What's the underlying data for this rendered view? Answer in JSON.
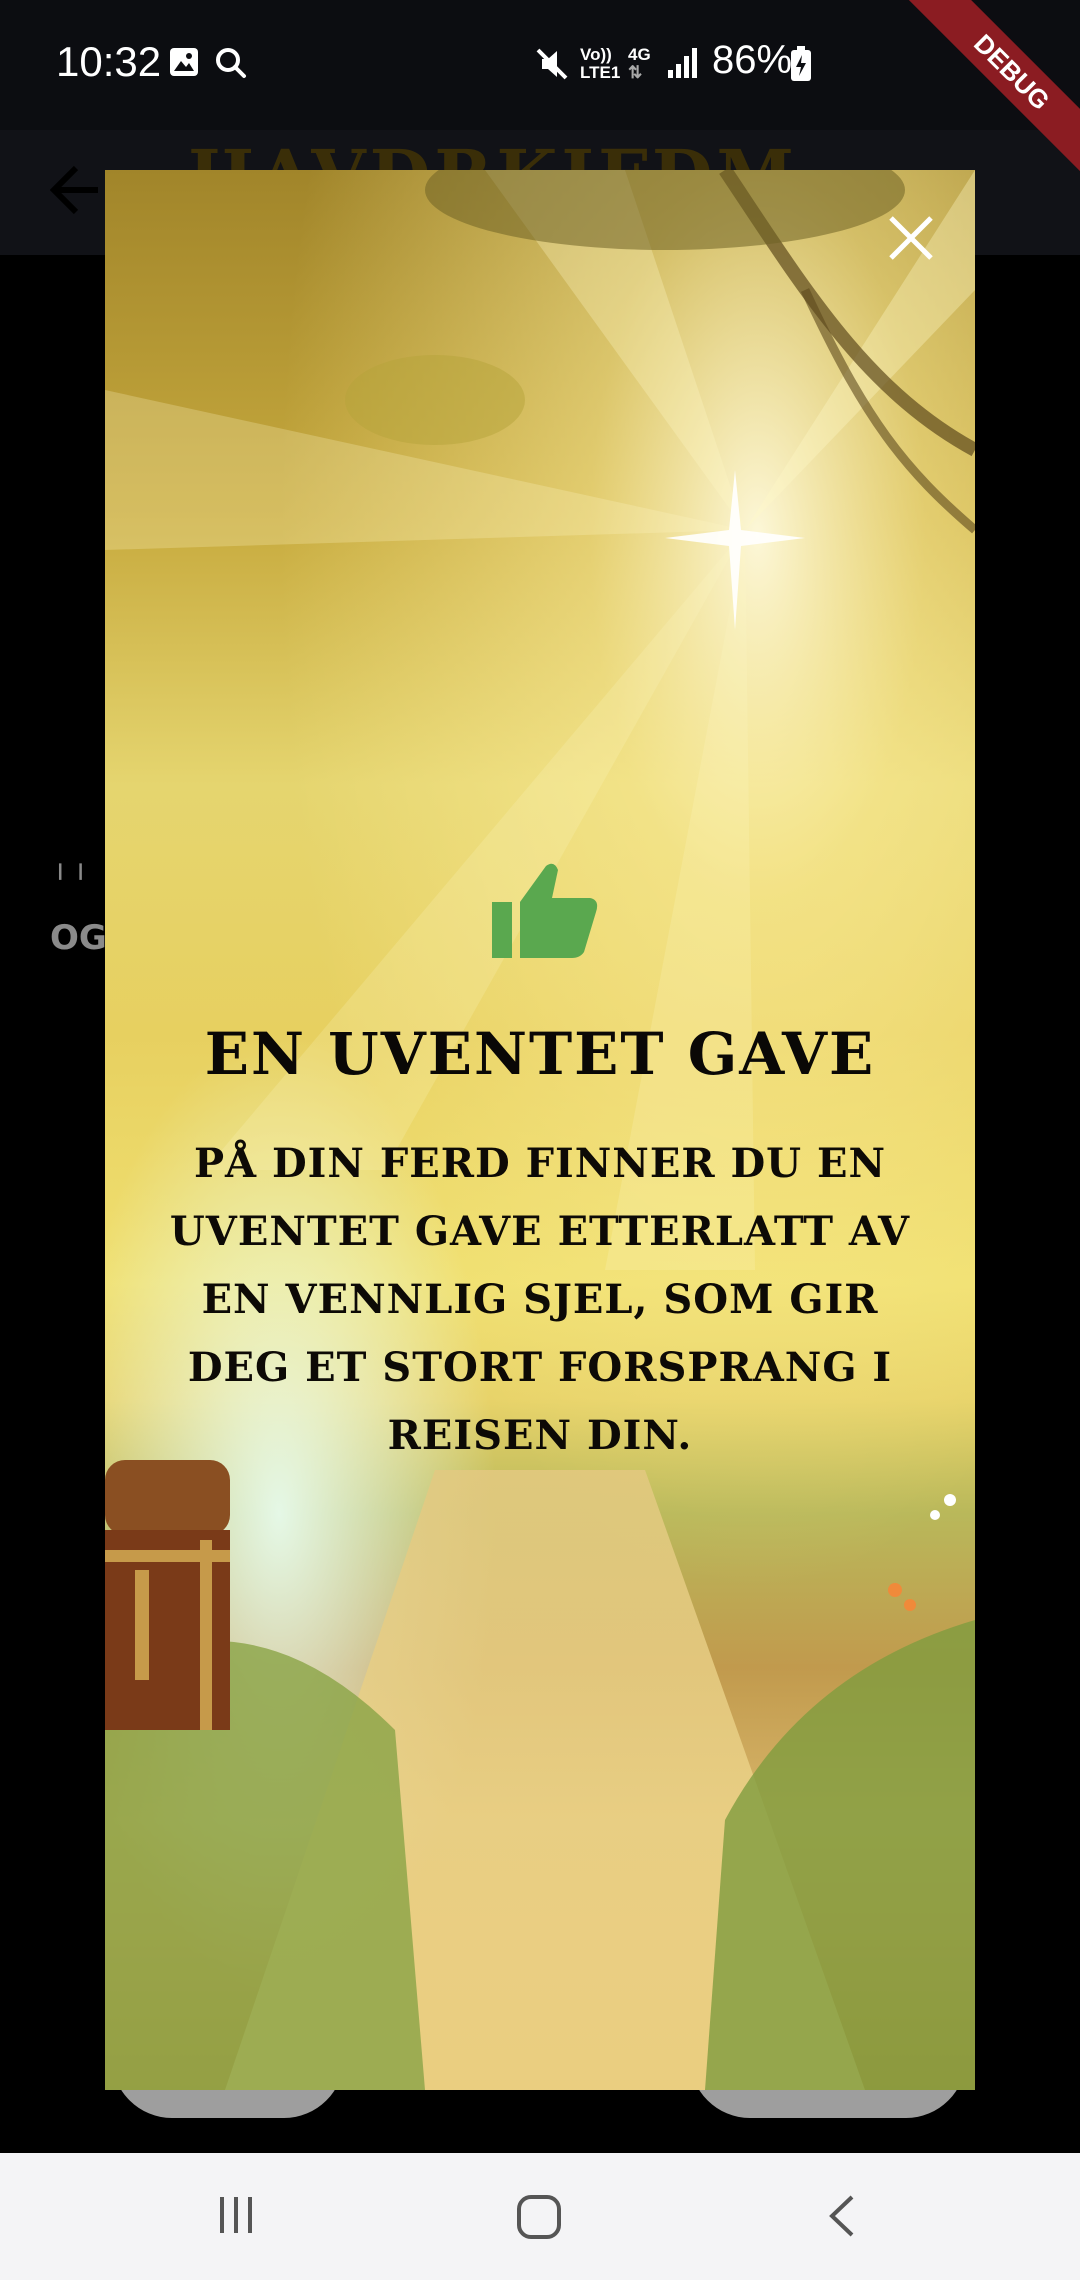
{
  "status_bar": {
    "time": "10:32",
    "battery": "86%",
    "volte_label_top": "Vo))",
    "volte_label_bottom": "LTE1",
    "network_label": "4G",
    "icons": [
      "image-icon",
      "search-icon",
      "mute-icon",
      "signal-icon",
      "battery-icon"
    ]
  },
  "app_bar": {
    "title": "HAVDRKIFDM"
  },
  "debug_banner": "DEBUG",
  "background_glyphs": [
    "ᛌᛌ",
    "OG"
  ],
  "dialog": {
    "title": "EN UVENTET GAVE",
    "body": "PÅ DIN FERD FINNER DU EN UVENTET GAVE ETTERLATT AV EN VENNLIG SJEL, SOM GIR DEG ET STORT FORSPRANG I REISEN DIN.",
    "icon": "thumbs-up-icon",
    "icon_color": "#5aa84f"
  },
  "nav_bar": {
    "buttons": [
      "recent-apps",
      "home",
      "back"
    ]
  },
  "colors": {
    "status_bar_bg": "#0c0d11",
    "nav_bar_bg": "#f4f4f6",
    "debug_ribbon": "#8b1c22"
  }
}
